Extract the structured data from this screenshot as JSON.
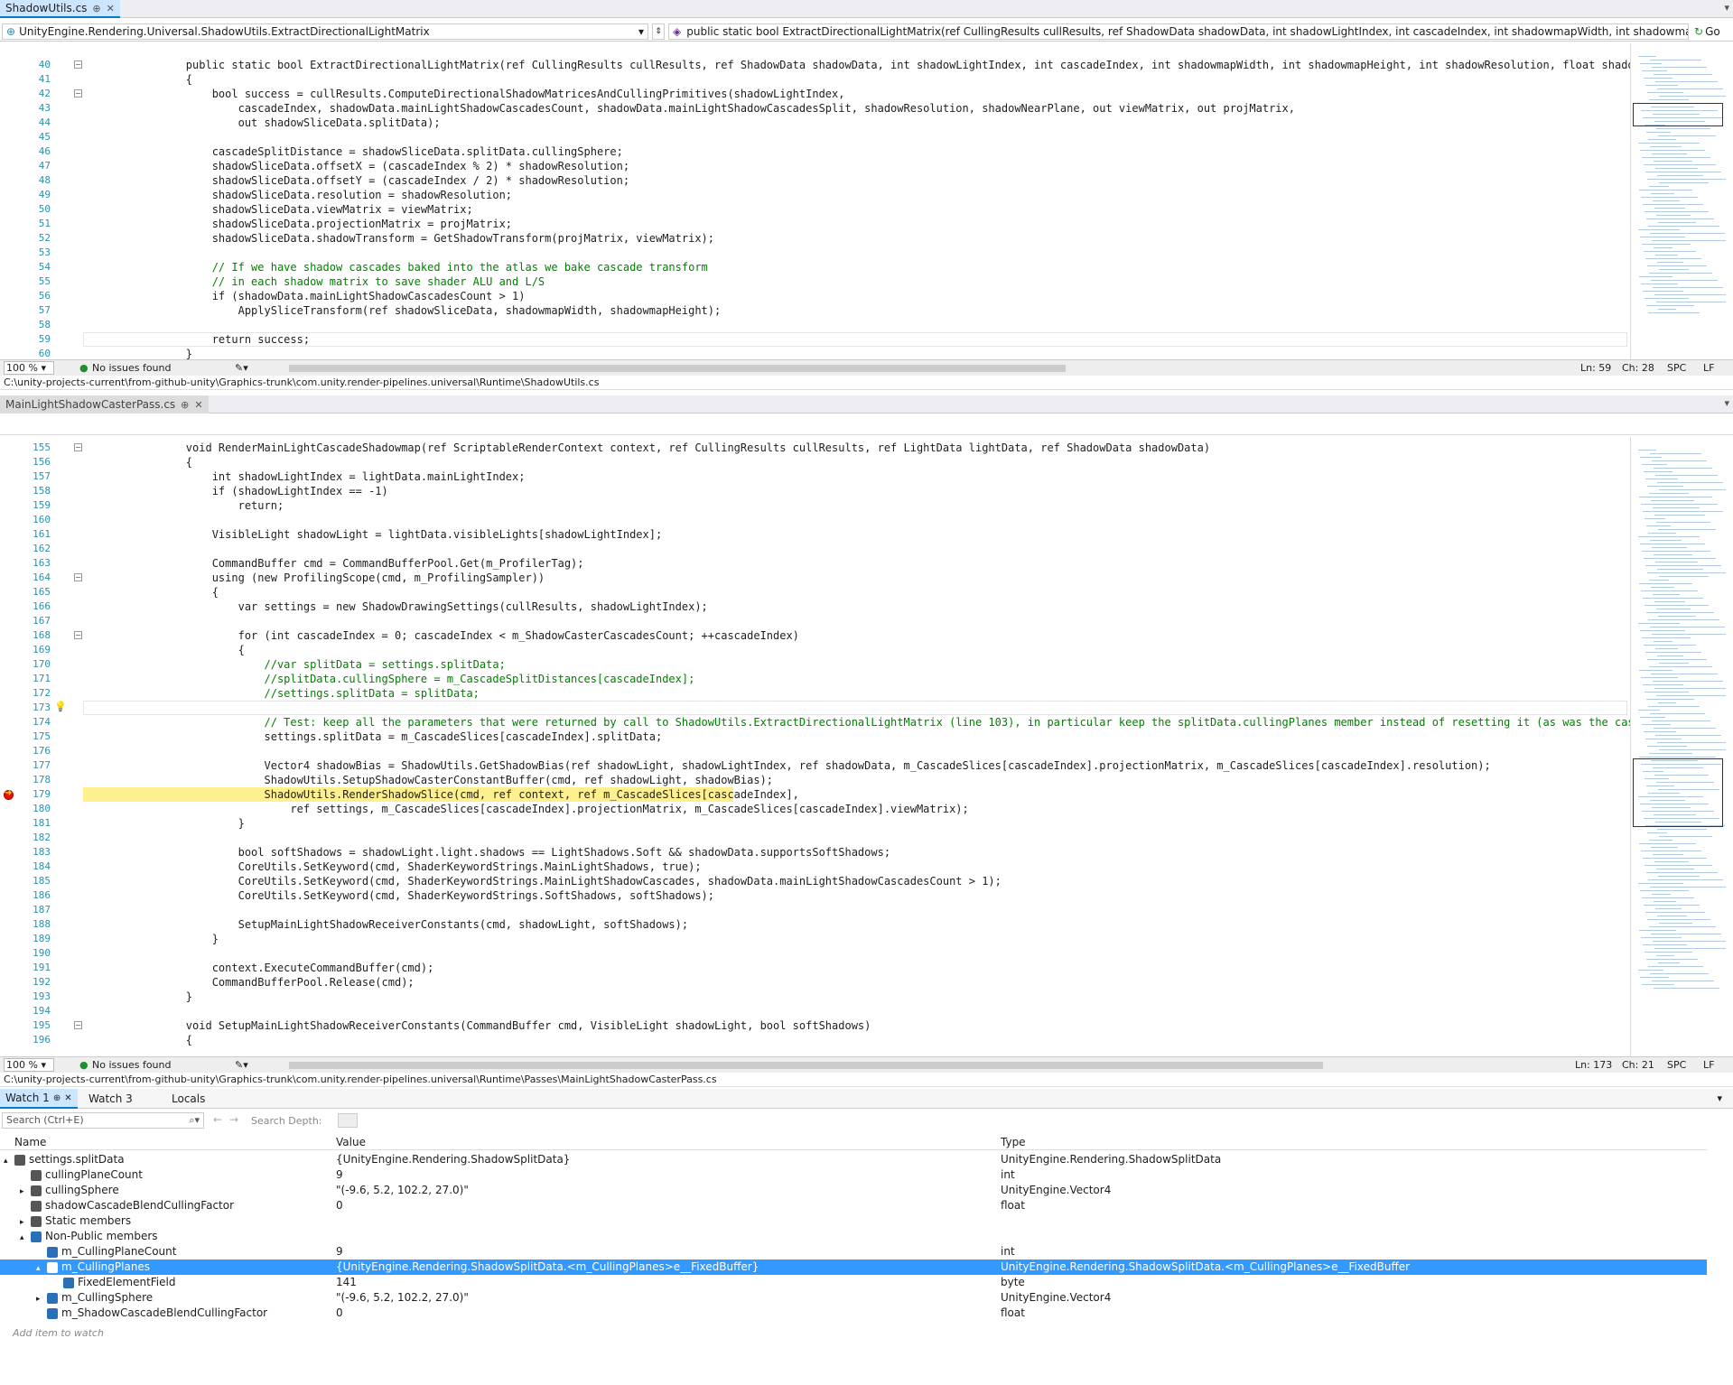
{
  "editor1": {
    "tab_title": "ShadowUtils.cs",
    "nav_namespace": "UnityEngine.Rendering.Universal.ShadowUtils.ExtractDirectionalLightMatrix",
    "nav_member": "public static bool ExtractDirectionalLightMatrix(ref CullingResults cullResults, ref ShadowData shadowData, int shadowLightIndex, int cascadeIndex, int shadowmapWidth, int shadowmapHeight, int shadowF",
    "go_label": "Go",
    "lines": [
      {
        "n": "40",
        "t": "        public static bool ExtractDirectionalLightMatrix(ref CullingResults cullResults, ref ShadowData shadowData, int shadowLightIndex, int cascadeIndex, int shadowmapWidth, int shadowmapHeight, int shadowResolution, float shadowNearPlane, ou"
      },
      {
        "n": "41",
        "t": "        {"
      },
      {
        "n": "42",
        "t": "            bool success = cullResults.ComputeDirectionalShadowMatricesAndCullingPrimitives(shadowLightIndex,"
      },
      {
        "n": "43",
        "t": "                cascadeIndex, shadowData.mainLightShadowCascadesCount, shadowData.mainLightShadowCascadesSplit, shadowResolution, shadowNearPlane, out viewMatrix, out projMatrix,"
      },
      {
        "n": "44",
        "t": "                out shadowSliceData.splitData);"
      },
      {
        "n": "45",
        "t": ""
      },
      {
        "n": "46",
        "t": "            cascadeSplitDistance = shadowSliceData.splitData.cullingSphere;"
      },
      {
        "n": "47",
        "t": "            shadowSliceData.offsetX = (cascadeIndex % 2) * shadowResolution;"
      },
      {
        "n": "48",
        "t": "            shadowSliceData.offsetY = (cascadeIndex / 2) * shadowResolution;"
      },
      {
        "n": "49",
        "t": "            shadowSliceData.resolution = shadowResolution;"
      },
      {
        "n": "50",
        "t": "            shadowSliceData.viewMatrix = viewMatrix;"
      },
      {
        "n": "51",
        "t": "            shadowSliceData.projectionMatrix = projMatrix;"
      },
      {
        "n": "52",
        "t": "            shadowSliceData.shadowTransform = GetShadowTransform(projMatrix, viewMatrix);"
      },
      {
        "n": "53",
        "t": ""
      },
      {
        "n": "54",
        "t": "            // If we have shadow cascades baked into the atlas we bake cascade transform"
      },
      {
        "n": "55",
        "t": "            // in each shadow matrix to save shader ALU and L/S"
      },
      {
        "n": "56",
        "t": "            if (shadowData.mainLightShadowCascadesCount > 1)"
      },
      {
        "n": "57",
        "t": "                ApplySliceTransform(ref shadowSliceData, shadowmapWidth, shadowmapHeight);"
      },
      {
        "n": "58",
        "t": ""
      },
      {
        "n": "59",
        "t": "            return success;"
      },
      {
        "n": "60",
        "t": "        }"
      }
    ],
    "zoom": "100 %",
    "issues": "No issues found",
    "ln": "Ln: 59",
    "ch": "Ch: 28",
    "spc": "SPC",
    "lf": "LF",
    "path": "C:\\unity-projects-current\\from-github-unity\\Graphics-trunk\\com.unity.render-pipelines.universal\\Runtime\\ShadowUtils.cs"
  },
  "editor2": {
    "tab_title": "MainLightShadowCasterPass.cs",
    "lines": [
      {
        "n": "155",
        "t": "        void RenderMainLightCascadeShadowmap(ref ScriptableRenderContext context, ref CullingResults cullResults, ref LightData lightData, ref ShadowData shadowData)"
      },
      {
        "n": "156",
        "t": "        {"
      },
      {
        "n": "157",
        "t": "            int shadowLightIndex = lightData.mainLightIndex;"
      },
      {
        "n": "158",
        "t": "            if (shadowLightIndex == -1)"
      },
      {
        "n": "159",
        "t": "                return;"
      },
      {
        "n": "160",
        "t": ""
      },
      {
        "n": "161",
        "t": "            VisibleLight shadowLight = lightData.visibleLights[shadowLightIndex];"
      },
      {
        "n": "162",
        "t": ""
      },
      {
        "n": "163",
        "t": "            CommandBuffer cmd = CommandBufferPool.Get(m_ProfilerTag);"
      },
      {
        "n": "164",
        "t": "            using (new ProfilingScope(cmd, m_ProfilingSampler))"
      },
      {
        "n": "165",
        "t": "            {"
      },
      {
        "n": "166",
        "t": "                var settings = new ShadowDrawingSettings(cullResults, shadowLightIndex);"
      },
      {
        "n": "167",
        "t": ""
      },
      {
        "n": "168",
        "t": "                for (int cascadeIndex = 0; cascadeIndex < m_ShadowCasterCascadesCount; ++cascadeIndex)"
      },
      {
        "n": "169",
        "t": "                {"
      },
      {
        "n": "170",
        "t": "                    //var splitData = settings.splitData;"
      },
      {
        "n": "171",
        "t": "                    //splitData.cullingSphere = m_CascadeSplitDistances[cascadeIndex];"
      },
      {
        "n": "172",
        "t": "                    //settings.splitData = splitData;"
      },
      {
        "n": "173",
        "t": ""
      },
      {
        "n": "174",
        "t": "                    // Test: keep all the parameters that were returned by call to ShadowUtils.ExtractDirectionalLightMatrix (line 103), in particular keep the splitData.cullingPlanes member instead of resetting it (as was the case in code bloc"
      },
      {
        "n": "175",
        "t": "                    settings.splitData = m_CascadeSlices[cascadeIndex].splitData;"
      },
      {
        "n": "176",
        "t": ""
      },
      {
        "n": "177",
        "t": "                    Vector4 shadowBias = ShadowUtils.GetShadowBias(ref shadowLight, shadowLightIndex, ref shadowData, m_CascadeSlices[cascadeIndex].projectionMatrix, m_CascadeSlices[cascadeIndex].resolution);"
      },
      {
        "n": "178",
        "t": "                    ShadowUtils.SetupShadowCasterConstantBuffer(cmd, ref shadowLight, shadowBias);"
      },
      {
        "n": "179",
        "t": "                    ShadowUtils.RenderShadowSlice(cmd, ref context, ref m_CascadeSlices[cascadeIndex],"
      },
      {
        "n": "180",
        "t": "                        ref settings, m_CascadeSlices[cascadeIndex].projectionMatrix, m_CascadeSlices[cascadeIndex].viewMatrix);"
      },
      {
        "n": "181",
        "t": "                }"
      },
      {
        "n": "182",
        "t": ""
      },
      {
        "n": "183",
        "t": "                bool softShadows = shadowLight.light.shadows == LightShadows.Soft && shadowData.supportsSoftShadows;"
      },
      {
        "n": "184",
        "t": "                CoreUtils.SetKeyword(cmd, ShaderKeywordStrings.MainLightShadows, true);"
      },
      {
        "n": "185",
        "t": "                CoreUtils.SetKeyword(cmd, ShaderKeywordStrings.MainLightShadowCascades, shadowData.mainLightShadowCascadesCount > 1);"
      },
      {
        "n": "186",
        "t": "                CoreUtils.SetKeyword(cmd, ShaderKeywordStrings.SoftShadows, softShadows);"
      },
      {
        "n": "187",
        "t": ""
      },
      {
        "n": "188",
        "t": "                SetupMainLightShadowReceiverConstants(cmd, shadowLight, softShadows);"
      },
      {
        "n": "189",
        "t": "            }"
      },
      {
        "n": "190",
        "t": ""
      },
      {
        "n": "191",
        "t": "            context.ExecuteCommandBuffer(cmd);"
      },
      {
        "n": "192",
        "t": "            CommandBufferPool.Release(cmd);"
      },
      {
        "n": "193",
        "t": "        }"
      },
      {
        "n": "194",
        "t": ""
      },
      {
        "n": "195",
        "t": "        void SetupMainLightShadowReceiverConstants(CommandBuffer cmd, VisibleLight shadowLight, bool softShadows)"
      },
      {
        "n": "196",
        "t": "        {"
      }
    ],
    "zoom": "100 %",
    "issues": "No issues found",
    "ln": "Ln: 173",
    "ch": "Ch: 21",
    "spc": "SPC",
    "lf": "LF",
    "path": "C:\\unity-projects-current\\from-github-unity\\Graphics-trunk\\com.unity.render-pipelines.universal\\Runtime\\Passes\\MainLightShadowCasterPass.cs"
  },
  "watch": {
    "tabs": [
      "Watch 1",
      "Watch 3",
      "Locals"
    ],
    "search_placeholder": "Search (Ctrl+E)",
    "search_depth_label": "Search Depth:",
    "col_name": "Name",
    "col_value": "Value",
    "col_type": "Type",
    "rows": [
      {
        "name": "settings.splitData",
        "value": "{UnityEngine.Rendering.ShadowSplitData}",
        "type": "UnityEngine.Rendering.ShadowSplitData"
      },
      {
        "name": "cullingPlaneCount",
        "value": "9",
        "type": "int"
      },
      {
        "name": "cullingSphere",
        "value": "\"(-9.6, 5.2, 102.2, 27.0)\"",
        "type": "UnityEngine.Vector4"
      },
      {
        "name": "shadowCascadeBlendCullingFactor",
        "value": "0",
        "type": "float"
      },
      {
        "name": "Static members",
        "value": "",
        "type": ""
      },
      {
        "name": "Non-Public members",
        "value": "",
        "type": ""
      },
      {
        "name": "m_CullingPlaneCount",
        "value": "9",
        "type": "int"
      },
      {
        "name": "m_CullingPlanes",
        "value": "{UnityEngine.Rendering.ShadowSplitData.<m_CullingPlanes>e__FixedBuffer}",
        "type": "UnityEngine.Rendering.ShadowSplitData.<m_CullingPlanes>e__FixedBuffer"
      },
      {
        "name": "FixedElementField",
        "value": "141",
        "type": "byte"
      },
      {
        "name": "m_CullingSphere",
        "value": "\"(-9.6, 5.2, 102.2, 27.0)\"",
        "type": "UnityEngine.Vector4"
      },
      {
        "name": "m_ShadowCascadeBlendCullingFactor",
        "value": "0",
        "type": "float"
      }
    ],
    "add_item": "Add item to watch"
  },
  "colors": {
    "accent": "#007acc",
    "selection": "#3399ff",
    "highlight": "#fff08f",
    "lineno": "#2b91af"
  }
}
